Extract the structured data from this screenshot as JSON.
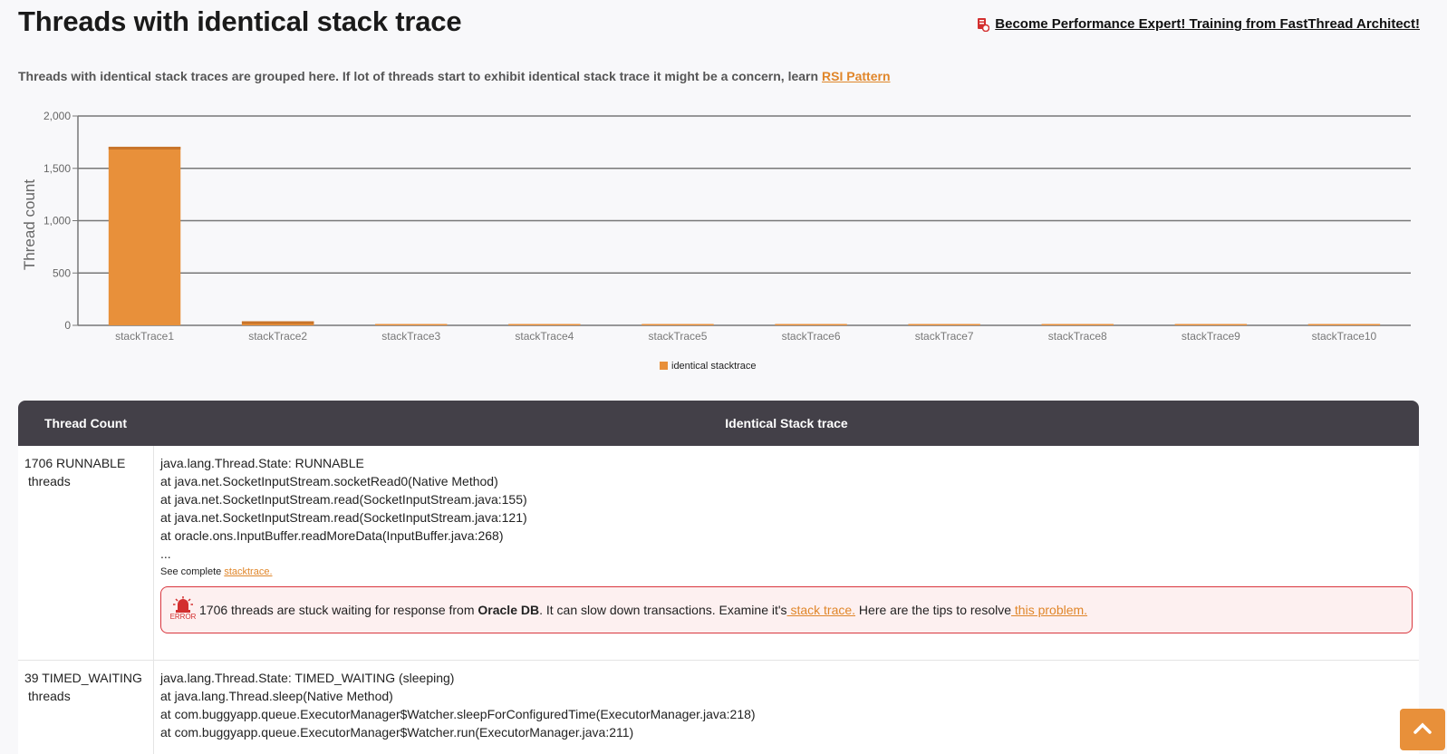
{
  "header": {
    "title": "Threads with identical stack trace",
    "promo_link": "Become Performance Expert! Training from FastThread Architect!"
  },
  "intro": {
    "text": "Threads with identical stack traces are grouped here. If lot of threads start to exhibit identical stack trace it might be a concern, learn",
    "link": "RSI Pattern"
  },
  "chart_data": {
    "type": "bar",
    "categories": [
      "stackTrace1",
      "stackTrace2",
      "stackTrace3",
      "stackTrace4",
      "stackTrace5",
      "stackTrace6",
      "stackTrace7",
      "stackTrace8",
      "stackTrace9",
      "stackTrace10"
    ],
    "series": [
      {
        "name": "identical stacktrace",
        "values": [
          1706,
          39,
          12,
          12,
          6,
          6,
          5,
          5,
          5,
          3
        ]
      }
    ],
    "ylabel": "Thread count",
    "xlabel": "",
    "ylim": [
      0,
      2000
    ],
    "yticks": [
      "0",
      "500",
      "1,000",
      "1,500",
      "2,000"
    ],
    "legend_position": "bottom",
    "color": "#e8903a",
    "grid": true
  },
  "table": {
    "headers": {
      "count": "Thread Count",
      "trace": "Identical Stack trace"
    },
    "rows": [
      {
        "count": "1706 RUNNABLE",
        "count_sub": "threads",
        "lines": [
          "java.lang.Thread.State: RUNNABLE",
          "at java.net.SocketInputStream.socketRead0(Native Method)",
          "at java.net.SocketInputStream.read(SocketInputStream.java:155)",
          "at java.net.SocketInputStream.read(SocketInputStream.java:121)",
          "at oracle.ons.InputBuffer.readMoreData(InputBuffer.java:268)",
          "..."
        ],
        "see_prefix": "See complete",
        "see_link": "stacktrace.",
        "alert": {
          "icon_label": "ERROR",
          "pre": "1706 threads are stuck waiting for response from",
          "bold": "Oracle DB",
          "mid": ". It can slow down transactions.  Examine it's",
          "link1": " stack trace.",
          "mid2": " Here are the tips to resolve",
          "link2": " this problem."
        }
      },
      {
        "count": "39 TIMED_WAITING",
        "count_sub": "threads",
        "lines": [
          "java.lang.Thread.State: TIMED_WAITING (sleeping)",
          "at java.lang.Thread.sleep(Native Method)",
          "at com.buggyapp.queue.ExecutorManager$Watcher.sleepForConfiguredTime(ExecutorManager.java:218)",
          "at com.buggyapp.queue.ExecutorManager$Watcher.run(ExecutorManager.java:211)"
        ]
      }
    ]
  }
}
